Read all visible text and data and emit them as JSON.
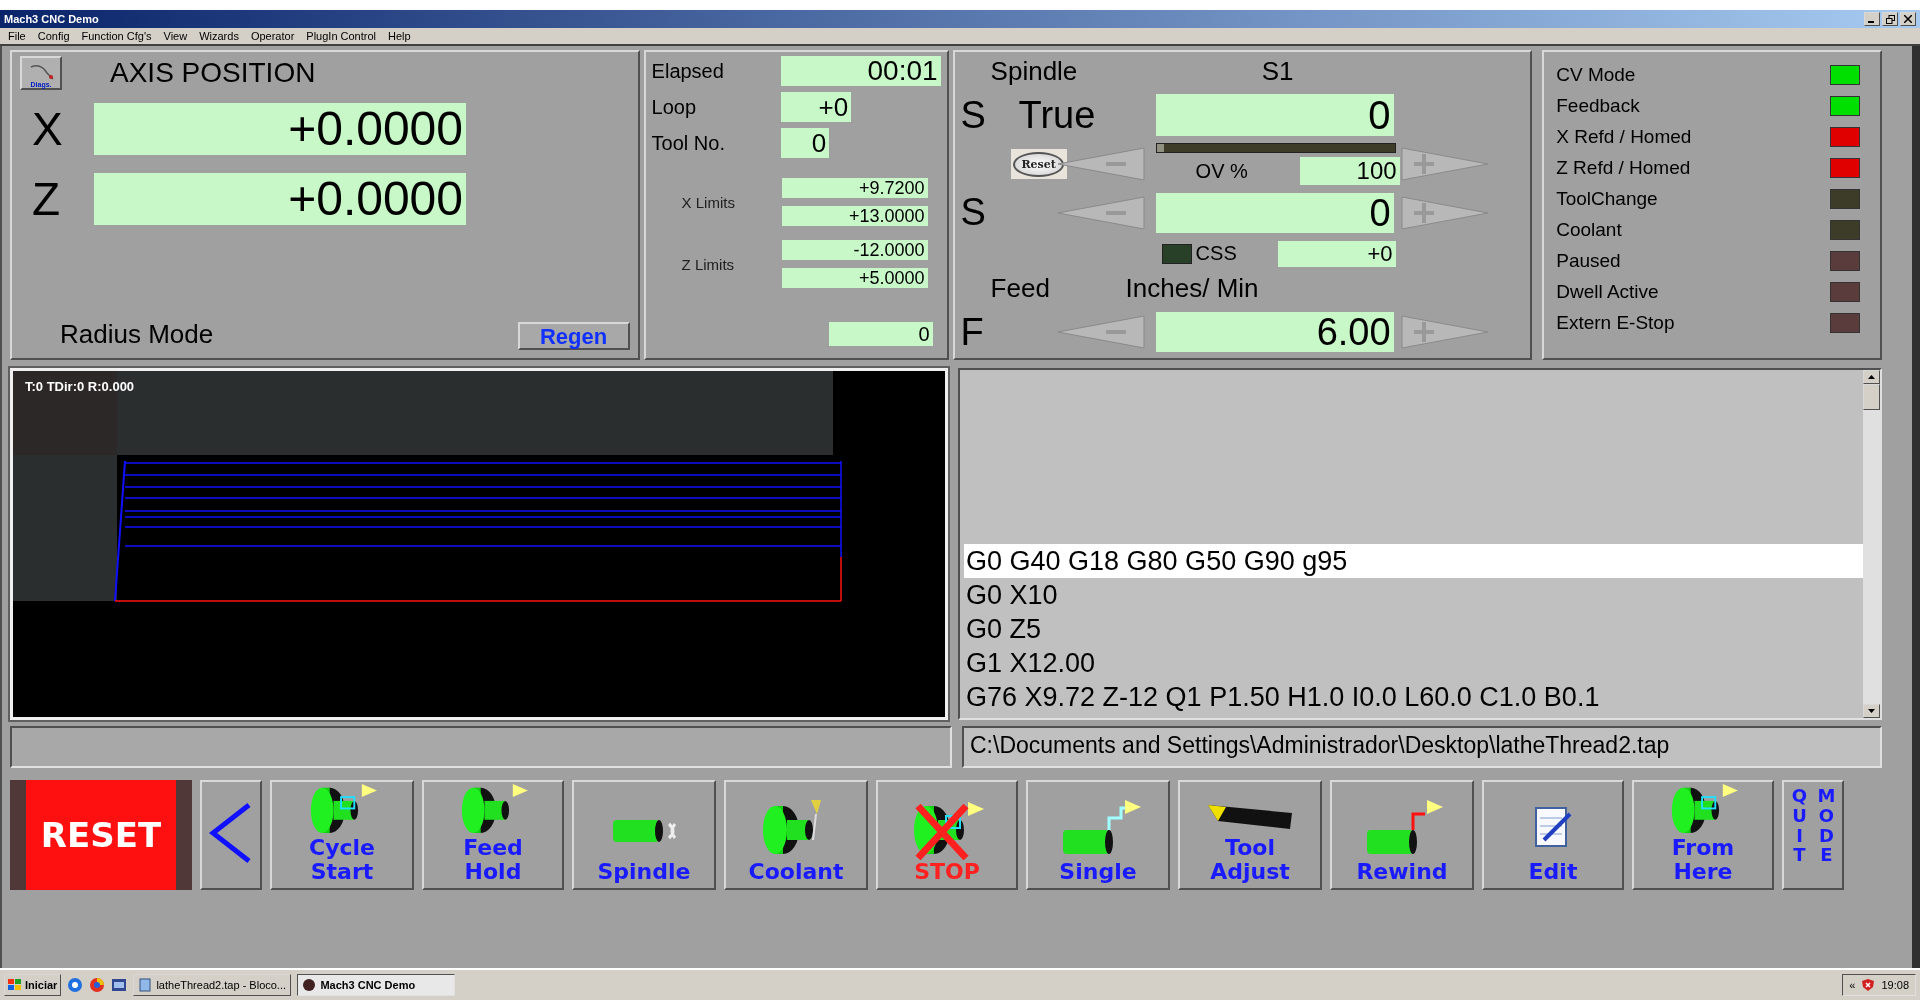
{
  "window": {
    "title": "Mach3 CNC  Demo"
  },
  "menu": [
    "File",
    "Config",
    "Function Cfg's",
    "View",
    "Wizards",
    "Operator",
    "PlugIn Control",
    "Help"
  ],
  "axis_panel": {
    "diags_label": "Diags.",
    "title": "AXIS POSITION",
    "axes": [
      {
        "name": "X",
        "value": "+0.0000"
      },
      {
        "name": "Z",
        "value": "+0.0000"
      }
    ],
    "mode": "Radius Mode",
    "regen_button": "Regen"
  },
  "job_panel": {
    "rows": [
      {
        "label": "Elapsed",
        "value": "00:01"
      },
      {
        "label": "Loop",
        "value": "+0"
      },
      {
        "label": "Tool No.",
        "value": "0"
      }
    ],
    "limits": [
      {
        "label": "X Limits",
        "values": [
          "+9.7200",
          "+13.0000"
        ]
      },
      {
        "label": "Z Limits",
        "values": [
          "-12.0000",
          "+5.0000"
        ]
      }
    ],
    "counter": "0"
  },
  "spindle_panel": {
    "title": "Spindle",
    "channel": "S1",
    "true_letter": "S",
    "true_label": "True",
    "true_value": "0",
    "reset_button": "Reset",
    "load_meter": {
      "level": 0.03
    },
    "override_label": "OV %",
    "override_value": "100",
    "speed_letter": "S",
    "speed_value": "0",
    "css": {
      "on": false,
      "label": "CSS",
      "value": "+0"
    },
    "feed_title": "Feed",
    "feed_units": "Inches/ Min",
    "feed_letter": "F",
    "feed_value": "6.00"
  },
  "indicators": [
    {
      "label": "CV Mode",
      "color": "#00e000"
    },
    {
      "label": "Feedback",
      "color": "#00e000"
    },
    {
      "label": "X Refd / Homed",
      "color": "#e00000"
    },
    {
      "label": "Z Refd / Homed",
      "color": "#e00000"
    },
    {
      "label": "ToolChange",
      "color": "#3c3c28"
    },
    {
      "label": "Coolant",
      "color": "#3c3c28"
    },
    {
      "label": "Paused",
      "color": "#5a3c3c"
    },
    {
      "label": "Dwell Active",
      "color": "#5a3c3c"
    },
    {
      "label": "Extern E-Stop",
      "color": "#5a3c3c"
    }
  ],
  "toolpath": {
    "status": "T:0 TDir:0 R:0.000"
  },
  "gcode": {
    "lines": [
      {
        "text": "G0 G40 G18 G80 G50 G90 g95",
        "selected": true
      },
      {
        "text": "G0 X10",
        "selected": false
      },
      {
        "text": "G0 Z5",
        "selected": false
      },
      {
        "text": "G1 X12.00",
        "selected": false
      },
      {
        "text": "G76 X9.72 Z-12 Q1 P1.50 H1.0 I0.0 L60.0 C1.0 B0.1",
        "selected": false
      }
    ],
    "file_path": "C:\\Documents and Settings\\Administrador\\Desktop\\latheThread2.tap"
  },
  "buttons": [
    {
      "kind": "reset",
      "label": "RESET"
    },
    {
      "kind": "back"
    },
    {
      "kind": "cycle_start",
      "label": "Cycle Start"
    },
    {
      "kind": "feed_hold",
      "label": "Feed Hold"
    },
    {
      "kind": "spindle",
      "label": "Spindle"
    },
    {
      "kind": "coolant",
      "label": "Coolant"
    },
    {
      "kind": "stop",
      "label": "STOP"
    },
    {
      "kind": "single",
      "label": "Single"
    },
    {
      "kind": "tool_adjust",
      "label": "Tool Adjust"
    },
    {
      "kind": "rewind",
      "label": "Rewind"
    },
    {
      "kind": "edit",
      "label": "Edit"
    },
    {
      "kind": "from_here",
      "label": "From Here"
    },
    {
      "kind": "quit_mode",
      "labels": [
        "QUIT",
        "MODE"
      ]
    }
  ],
  "taskbar": {
    "start": "Iniciar",
    "tasks": [
      {
        "label": "latheThread2.tap - Bloco...",
        "selected": false
      },
      {
        "label": "Mach3 CNC  Demo",
        "selected": true
      }
    ],
    "tray_toggle": "«",
    "clock": "19:08"
  }
}
